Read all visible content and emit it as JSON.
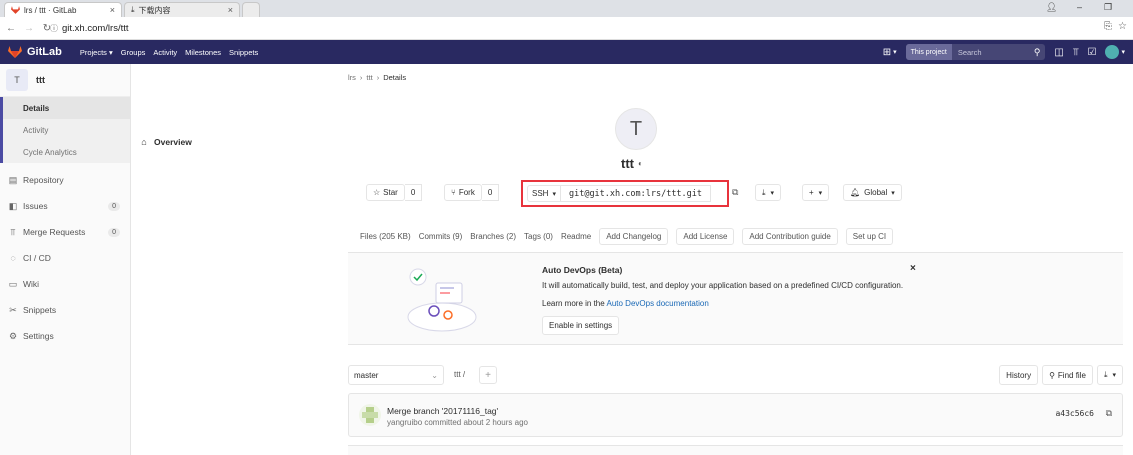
{
  "browser": {
    "tabs": [
      {
        "title": "lrs / ttt · GitLab",
        "close": "×"
      },
      {
        "title": "下载内容",
        "close": "×"
      }
    ],
    "url": "git.xh.com/lrs/ttt"
  },
  "header": {
    "logo_text": "GitLab",
    "nav": [
      {
        "label": "Projects ▾"
      },
      {
        "label": "Groups"
      },
      {
        "label": "Activity"
      },
      {
        "label": "Milestones"
      },
      {
        "label": "Snippets"
      }
    ],
    "search_scope": "This project",
    "search_placeholder": "Search"
  },
  "sidebar": {
    "project_initial": "T",
    "project_name": "ttt",
    "overview": {
      "label": "Overview",
      "sub": [
        {
          "label": "Details"
        },
        {
          "label": "Activity"
        },
        {
          "label": "Cycle Analytics"
        }
      ]
    },
    "items": [
      {
        "label": "Repository",
        "count": ""
      },
      {
        "label": "Issues",
        "count": "0"
      },
      {
        "label": "Merge Requests",
        "count": "0"
      },
      {
        "label": "CI / CD",
        "count": ""
      },
      {
        "label": "Wiki",
        "count": ""
      },
      {
        "label": "Snippets",
        "count": ""
      },
      {
        "label": "Settings",
        "count": ""
      }
    ]
  },
  "breadcrumb": {
    "items": [
      "lrs",
      "ttt",
      "Details"
    ]
  },
  "project": {
    "initial": "T",
    "title": "ttt",
    "star_label": "Star",
    "star_count": "0",
    "fork_label": "Fork",
    "fork_count": "0",
    "clone_protocol": "SSH",
    "clone_url": "git@git.xh.com:lrs/ttt.git",
    "notification_label": "Global"
  },
  "stats": {
    "files": "Files (205 KB)",
    "commits": "Commits (9)",
    "branches": "Branches (2)",
    "tags": "Tags (0)",
    "readme": "Readme",
    "buttons": [
      "Add Changelog",
      "Add License",
      "Add Contribution guide",
      "Set up CI"
    ]
  },
  "devops": {
    "title": "Auto DevOps (Beta)",
    "description": "It will automatically build, test, and deploy your application based on a predefined CI/CD configuration.",
    "more_prefix": "Learn more in the ",
    "more_link": "Auto DevOps documentation",
    "button": "Enable in settings",
    "close": "×"
  },
  "tree": {
    "branch": "master",
    "path": "ttt /",
    "history": "History",
    "find_file": "Find file"
  },
  "commit": {
    "title": "Merge branch '20171116_tag'",
    "meta": "yangruibo committed about 2 hours ago",
    "sha": "a43c56c6"
  },
  "colors": {
    "header_bg": "#292961",
    "clone_highlight": "#e8333c",
    "link": "#1b69b6"
  }
}
